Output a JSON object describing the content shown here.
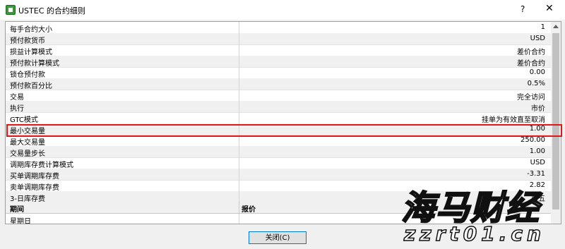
{
  "window": {
    "title": "USTEC 的合约细则",
    "help": "?",
    "close": "✕"
  },
  "rows": [
    {
      "label": "每手合约大小",
      "value": "1"
    },
    {
      "label": "预付款货币",
      "value": "USD"
    },
    {
      "label": "损益计算模式",
      "value": "差价合约"
    },
    {
      "label": "预付款计算模式",
      "value": "差价合约"
    },
    {
      "label": "锁仓预付款",
      "value": "0.00"
    },
    {
      "label": "预付款百分比",
      "value": "0.5%"
    },
    {
      "label": "交易",
      "value": "完全访问"
    },
    {
      "label": "执行",
      "value": "市价"
    },
    {
      "label": "GTC模式",
      "value": "挂单为有效直至取消"
    },
    {
      "label": "最小交易量",
      "value": "1.00"
    },
    {
      "label": "最大交易量",
      "value": "250.00"
    },
    {
      "label": "交易量步长",
      "value": "1.00"
    },
    {
      "label": "调期库存费计算模式",
      "value": "USD"
    },
    {
      "label": "买单调期库存费",
      "value": "-3.31"
    },
    {
      "label": "卖单调期库存费",
      "value": "2.82"
    },
    {
      "label": "3-日库存费",
      "value": "周五"
    }
  ],
  "schedule": {
    "col_period": "期间",
    "col_quote": "报价",
    "first_day": "星期日"
  },
  "buttons": {
    "close_label": "关闭(C)"
  },
  "watermark": {
    "main": "海马财经",
    "sub": "zzrt01.cn"
  },
  "colors": {
    "highlight": "#e01818",
    "focus_border": "#0078d7"
  },
  "icons": {
    "app": "app-icon",
    "help": "help-icon",
    "close": "close-icon"
  }
}
